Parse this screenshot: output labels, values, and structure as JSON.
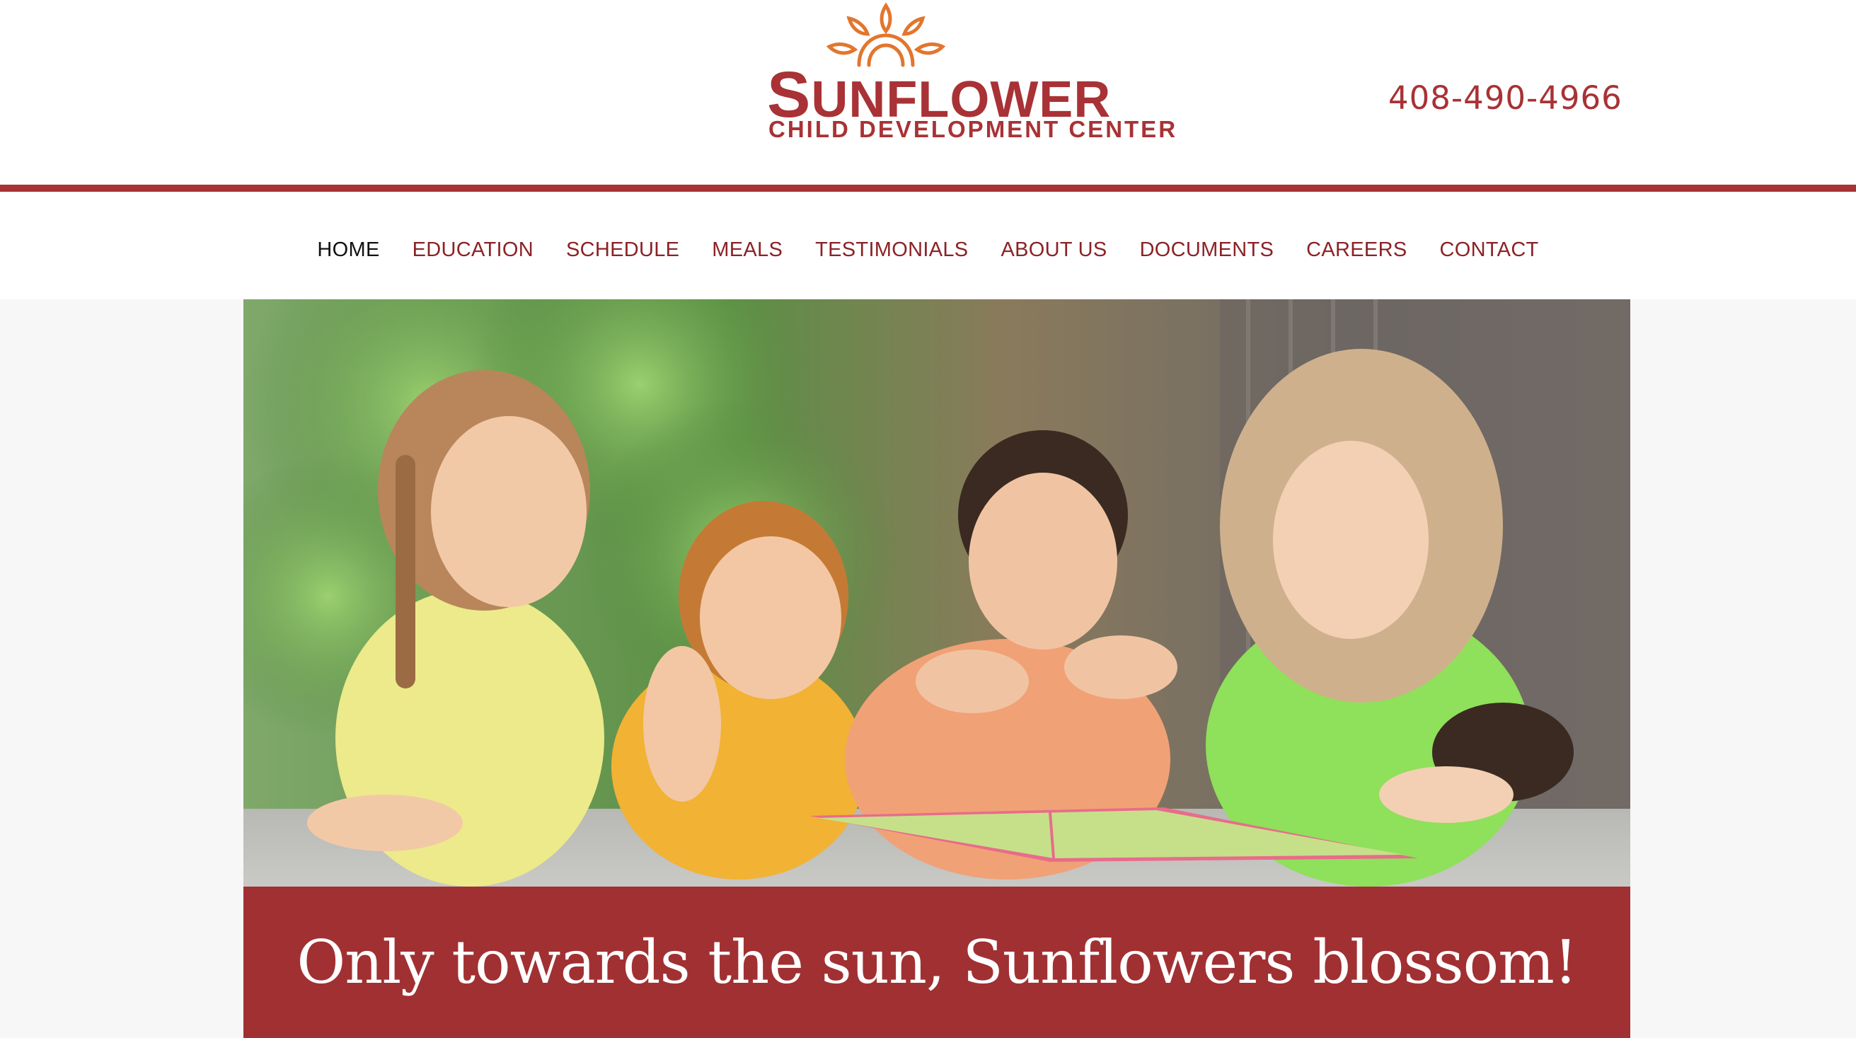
{
  "brand": {
    "name_initial": "S",
    "name_rest": "UNFLOWER",
    "subtitle": "CHILD DEVELOPMENT CENTER",
    "phone": "408-490-4966"
  },
  "nav": {
    "items": [
      {
        "label": "HOME",
        "active": true
      },
      {
        "label": "EDUCATION",
        "active": false
      },
      {
        "label": "SCHEDULE",
        "active": false
      },
      {
        "label": "MEALS",
        "active": false
      },
      {
        "label": "TESTIMONIALS",
        "active": false
      },
      {
        "label": "ABOUT US",
        "active": false
      },
      {
        "label": "DOCUMENTS",
        "active": false
      },
      {
        "label": "CAREERS",
        "active": false
      },
      {
        "label": "CONTACT",
        "active": false
      }
    ]
  },
  "hero": {
    "tagline": "Only towards the sun, Sunflowers blossom!"
  },
  "colors": {
    "brand_red": "#a83235",
    "banner_red": "#a13032",
    "logo_orange": "#e2762e",
    "nav_active": "#111111",
    "page_bg": "#f7f7f7"
  }
}
